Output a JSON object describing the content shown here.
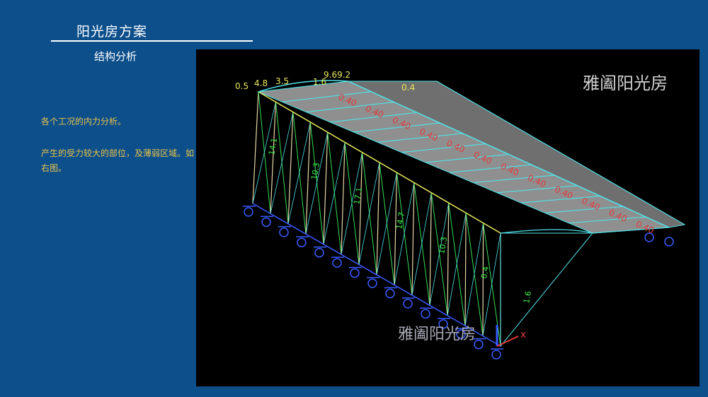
{
  "slide": {
    "title": "阳光房方案",
    "subtitle": "结构分析",
    "paragraphs": [
      "各个工况的内力分析。",
      "产生的受力较大的部位，及薄弱区域。如右图。"
    ]
  },
  "viewport": {
    "watermark_top": "雅阖阳光房",
    "watermark_bottom": "雅阖阳光房",
    "ridge_labels": [
      "0.5",
      "4.8",
      "3.5",
      "1.6",
      "9.69.2",
      "0.4"
    ],
    "panel_labels": [
      "0.40",
      "0.40",
      "0.40",
      "0.40",
      "0.40",
      "0.40",
      "0.40",
      "0.40",
      "0.40",
      "0.40",
      "0.40",
      "0.40"
    ],
    "column_labels": [
      "14.1",
      "10.3",
      "17.1",
      "14.7",
      "10.3",
      "0.4",
      "1.6"
    ],
    "axis_x_label": "x",
    "colors": {
      "frame": "#4fe3ea",
      "frame_alt": "#e8e85a",
      "diag": "#33dd55",
      "label_green": "#3cf24a",
      "label_red": "#e23a3a",
      "roof_fill": "#8f8f8f",
      "support": "#3a5cff",
      "post": "#e8d8a8"
    }
  }
}
